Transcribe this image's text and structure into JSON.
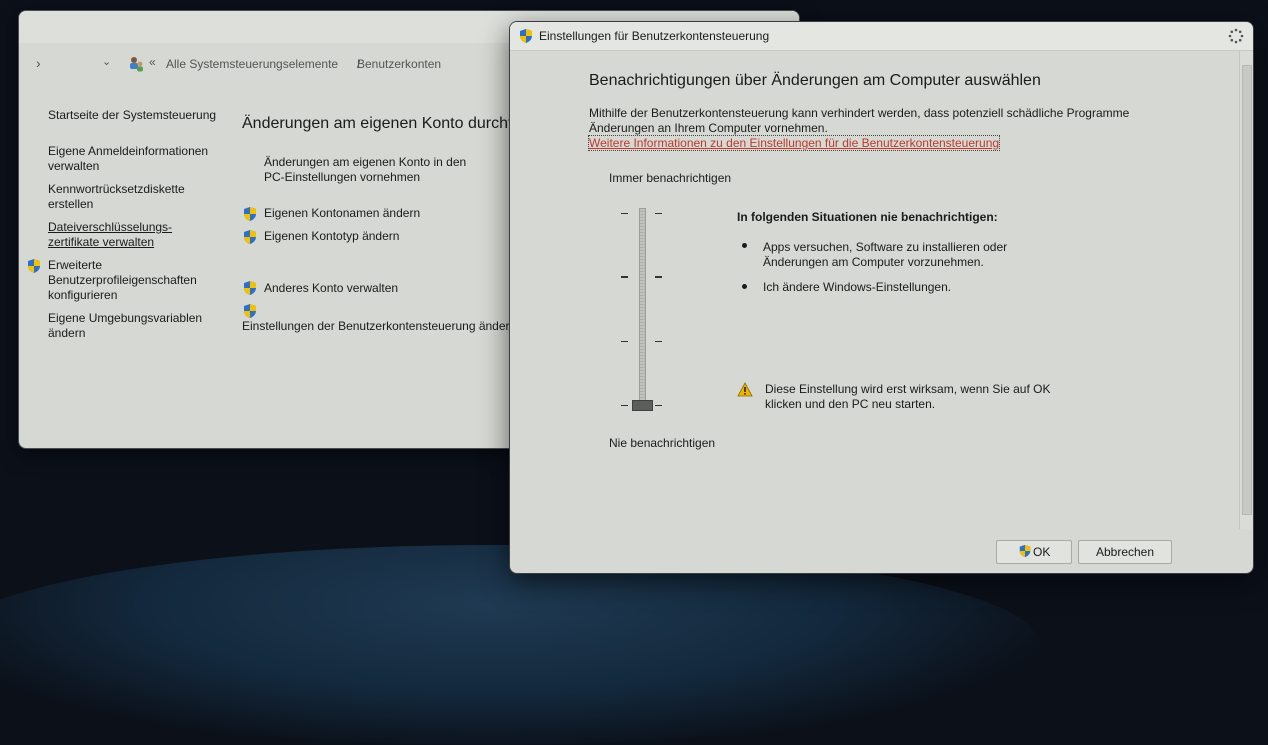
{
  "control_panel": {
    "breadcrumb_prefix": "«",
    "breadcrumb_1": "Alle Systemsteuerungselemente",
    "breadcrumb_sep": "/",
    "breadcrumb_2": "Benutzerkonten",
    "nav_chevron": "›",
    "nav_dropdown": "⌄",
    "sidebar": {
      "home": "Startseite der Systemsteuerung",
      "item1": "Eigene Anmeldeinformationen verwalten",
      "item1_l1": "Eigene Anmeldeinformationen",
      "item1_l2": "verwalten",
      "item2_l1": "Kennwortrücksetzdiskette",
      "item2_l2": "erstellen",
      "item3_l1": "Dateiverschlüsselungs-",
      "item3_l2": "zertifikate verwalten",
      "item4_l1": "Erweiterte",
      "item4_l2": "Benutzerprofileigenschaften",
      "item4_l3": "konfigurieren",
      "item5_l1": "Eigene Umgebungsvariablen",
      "item5_l2": "ändern"
    },
    "main": {
      "heading": "Änderungen am eigenen Konto durchfü",
      "pc_settings_l1": "Änderungen am eigenen Konto in den",
      "pc_settings_l2": "PC-Einstellungen vornehmen",
      "rename": "Eigenen Kontonamen ändern",
      "change_type": "Eigenen Kontotyp ändern",
      "other_account": "Anderes Konto verwalten",
      "uac_settings": "Einstellungen der Benutzerkontensteuerung ändern"
    }
  },
  "uac_dialog": {
    "title": "Einstellungen für Benutzerkontensteuerung",
    "heading": "Benachrichtigungen über Änderungen am Computer auswählen",
    "description_l1": "Mithilfe der Benutzerkontensteuerung kann verhindert werden, dass potenziell schädliche Programme",
    "description_l2": "Änderungen an Ihrem Computer vornehmen.",
    "more_info_link": "Weitere Informationen zu den Einstellungen für die Benutzerkontensteuerung",
    "slider_top_label": "Immer benachrichtigen",
    "slider_bottom_label": "Nie benachrichtigen",
    "slider_level": "Nie benachrichtigen",
    "info_heading": "In folgenden Situationen nie benachrichtigen:",
    "bullet1_l1": "Apps versuchen, Software zu installieren oder",
    "bullet1_l2": "Änderungen am Computer vorzunehmen.",
    "bullet2": "Ich ändere Windows-Einstellungen.",
    "warning_l1": "Diese Einstellung wird erst wirksam, wenn Sie auf OK",
    "warning_l2": "klicken und den PC neu starten.",
    "ok_label": "OK",
    "cancel_label": "Abbrechen"
  },
  "colors": {
    "link": "#c0392b",
    "window_bg": "#d5d8d3",
    "shield_blue": "#2f6fc8",
    "shield_yellow": "#f2c200",
    "warning_yellow": "#f0b400"
  }
}
